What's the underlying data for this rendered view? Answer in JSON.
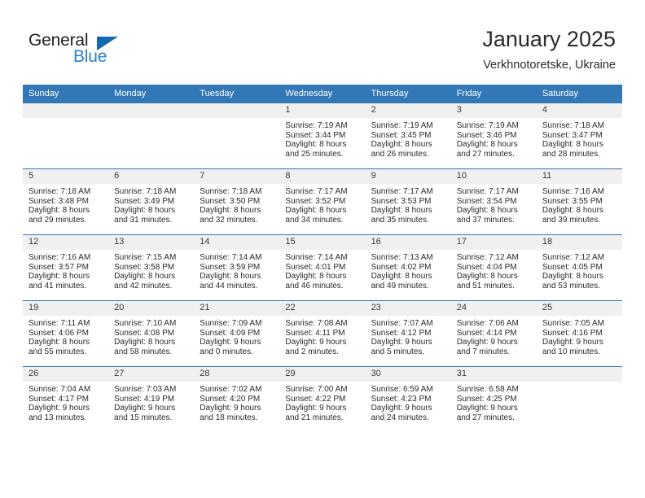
{
  "brand": {
    "name_part1": "General",
    "name_part2": "Blue",
    "accent_color": "#2a7fc9",
    "triangle_color": "#1168b3"
  },
  "header": {
    "title": "January 2025",
    "subtitle": "Verkhnotoretske, Ukraine",
    "header_bar_color": "#3277b6"
  },
  "weekday_headers": [
    "Sunday",
    "Monday",
    "Tuesday",
    "Wednesday",
    "Thursday",
    "Friday",
    "Saturday"
  ],
  "weeks": [
    [
      {
        "day": "",
        "lines": []
      },
      {
        "day": "",
        "lines": []
      },
      {
        "day": "",
        "lines": []
      },
      {
        "day": "1",
        "lines": [
          "Sunrise: 7:19 AM",
          "Sunset: 3:44 PM",
          "Daylight: 8 hours",
          "and 25 minutes."
        ]
      },
      {
        "day": "2",
        "lines": [
          "Sunrise: 7:19 AM",
          "Sunset: 3:45 PM",
          "Daylight: 8 hours",
          "and 26 minutes."
        ]
      },
      {
        "day": "3",
        "lines": [
          "Sunrise: 7:19 AM",
          "Sunset: 3:46 PM",
          "Daylight: 8 hours",
          "and 27 minutes."
        ]
      },
      {
        "day": "4",
        "lines": [
          "Sunrise: 7:18 AM",
          "Sunset: 3:47 PM",
          "Daylight: 8 hours",
          "and 28 minutes."
        ]
      }
    ],
    [
      {
        "day": "5",
        "lines": [
          "Sunrise: 7:18 AM",
          "Sunset: 3:48 PM",
          "Daylight: 8 hours",
          "and 29 minutes."
        ]
      },
      {
        "day": "6",
        "lines": [
          "Sunrise: 7:18 AM",
          "Sunset: 3:49 PM",
          "Daylight: 8 hours",
          "and 31 minutes."
        ]
      },
      {
        "day": "7",
        "lines": [
          "Sunrise: 7:18 AM",
          "Sunset: 3:50 PM",
          "Daylight: 8 hours",
          "and 32 minutes."
        ]
      },
      {
        "day": "8",
        "lines": [
          "Sunrise: 7:17 AM",
          "Sunset: 3:52 PM",
          "Daylight: 8 hours",
          "and 34 minutes."
        ]
      },
      {
        "day": "9",
        "lines": [
          "Sunrise: 7:17 AM",
          "Sunset: 3:53 PM",
          "Daylight: 8 hours",
          "and 35 minutes."
        ]
      },
      {
        "day": "10",
        "lines": [
          "Sunrise: 7:17 AM",
          "Sunset: 3:54 PM",
          "Daylight: 8 hours",
          "and 37 minutes."
        ]
      },
      {
        "day": "11",
        "lines": [
          "Sunrise: 7:16 AM",
          "Sunset: 3:55 PM",
          "Daylight: 8 hours",
          "and 39 minutes."
        ]
      }
    ],
    [
      {
        "day": "12",
        "lines": [
          "Sunrise: 7:16 AM",
          "Sunset: 3:57 PM",
          "Daylight: 8 hours",
          "and 41 minutes."
        ]
      },
      {
        "day": "13",
        "lines": [
          "Sunrise: 7:15 AM",
          "Sunset: 3:58 PM",
          "Daylight: 8 hours",
          "and 42 minutes."
        ]
      },
      {
        "day": "14",
        "lines": [
          "Sunrise: 7:14 AM",
          "Sunset: 3:59 PM",
          "Daylight: 8 hours",
          "and 44 minutes."
        ]
      },
      {
        "day": "15",
        "lines": [
          "Sunrise: 7:14 AM",
          "Sunset: 4:01 PM",
          "Daylight: 8 hours",
          "and 46 minutes."
        ]
      },
      {
        "day": "16",
        "lines": [
          "Sunrise: 7:13 AM",
          "Sunset: 4:02 PM",
          "Daylight: 8 hours",
          "and 49 minutes."
        ]
      },
      {
        "day": "17",
        "lines": [
          "Sunrise: 7:12 AM",
          "Sunset: 4:04 PM",
          "Daylight: 8 hours",
          "and 51 minutes."
        ]
      },
      {
        "day": "18",
        "lines": [
          "Sunrise: 7:12 AM",
          "Sunset: 4:05 PM",
          "Daylight: 8 hours",
          "and 53 minutes."
        ]
      }
    ],
    [
      {
        "day": "19",
        "lines": [
          "Sunrise: 7:11 AM",
          "Sunset: 4:06 PM",
          "Daylight: 8 hours",
          "and 55 minutes."
        ]
      },
      {
        "day": "20",
        "lines": [
          "Sunrise: 7:10 AM",
          "Sunset: 4:08 PM",
          "Daylight: 8 hours",
          "and 58 minutes."
        ]
      },
      {
        "day": "21",
        "lines": [
          "Sunrise: 7:09 AM",
          "Sunset: 4:09 PM",
          "Daylight: 9 hours",
          "and 0 minutes."
        ]
      },
      {
        "day": "22",
        "lines": [
          "Sunrise: 7:08 AM",
          "Sunset: 4:11 PM",
          "Daylight: 9 hours",
          "and 2 minutes."
        ]
      },
      {
        "day": "23",
        "lines": [
          "Sunrise: 7:07 AM",
          "Sunset: 4:12 PM",
          "Daylight: 9 hours",
          "and 5 minutes."
        ]
      },
      {
        "day": "24",
        "lines": [
          "Sunrise: 7:06 AM",
          "Sunset: 4:14 PM",
          "Daylight: 9 hours",
          "and 7 minutes."
        ]
      },
      {
        "day": "25",
        "lines": [
          "Sunrise: 7:05 AM",
          "Sunset: 4:16 PM",
          "Daylight: 9 hours",
          "and 10 minutes."
        ]
      }
    ],
    [
      {
        "day": "26",
        "lines": [
          "Sunrise: 7:04 AM",
          "Sunset: 4:17 PM",
          "Daylight: 9 hours",
          "and 13 minutes."
        ]
      },
      {
        "day": "27",
        "lines": [
          "Sunrise: 7:03 AM",
          "Sunset: 4:19 PM",
          "Daylight: 9 hours",
          "and 15 minutes."
        ]
      },
      {
        "day": "28",
        "lines": [
          "Sunrise: 7:02 AM",
          "Sunset: 4:20 PM",
          "Daylight: 9 hours",
          "and 18 minutes."
        ]
      },
      {
        "day": "29",
        "lines": [
          "Sunrise: 7:00 AM",
          "Sunset: 4:22 PM",
          "Daylight: 9 hours",
          "and 21 minutes."
        ]
      },
      {
        "day": "30",
        "lines": [
          "Sunrise: 6:59 AM",
          "Sunset: 4:23 PM",
          "Daylight: 9 hours",
          "and 24 minutes."
        ]
      },
      {
        "day": "31",
        "lines": [
          "Sunrise: 6:58 AM",
          "Sunset: 4:25 PM",
          "Daylight: 9 hours",
          "and 27 minutes."
        ]
      },
      {
        "day": "",
        "lines": []
      }
    ]
  ]
}
